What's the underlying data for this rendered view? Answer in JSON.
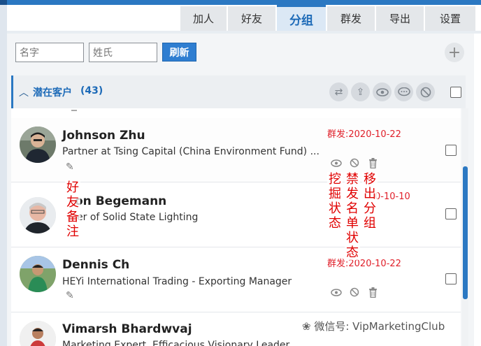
{
  "tabs": [
    {
      "label": "加人"
    },
    {
      "label": "好友"
    },
    {
      "label": "分组"
    },
    {
      "label": "群发"
    },
    {
      "label": "导出"
    },
    {
      "label": "设置"
    }
  ],
  "filters": {
    "first_name_placeholder": "名字",
    "last_name_placeholder": "姓氏",
    "refresh_label": "刷新",
    "add_label": "+"
  },
  "group": {
    "name": "潜在客户",
    "count": "(43)",
    "icons": [
      "swap-icon",
      "upload-icon",
      "eye-icon",
      "chat-icon",
      "block-icon"
    ]
  },
  "contacts": [
    {
      "name": "Johnson Zhu",
      "title": "Partner at Tsing Capital (China Environment Fund) ...",
      "date": "群发:2020-10-22",
      "show_actions": true
    },
    {
      "name": "Jon Begemann",
      "name_visible": "on Begemann",
      "title": "CEO of Solid State Lighting",
      "title_visible": "er of Solid State Lighting",
      "date": "0-10-10",
      "show_actions": false
    },
    {
      "name": "Dennis Ch",
      "title": "HEYi International Trading - Exporting Manager",
      "date": "群发:2020-10-22",
      "show_actions": true
    },
    {
      "name": "Vimarsh Bhardwvaj",
      "title": "Marketing Expert, Efficacious Visionary Leader",
      "date": "",
      "show_actions": false
    }
  ],
  "annotations": {
    "friend_note": "好友备注",
    "mine_status": "挖掘状态",
    "blacklist_status": "禁发名单状态",
    "remove_group": "移出分组"
  },
  "watermark": "微信号: VipMarketingClub",
  "colors": {
    "accent": "#2b78c2",
    "date_red": "#e0202a",
    "annotation_red": "#e00000"
  }
}
